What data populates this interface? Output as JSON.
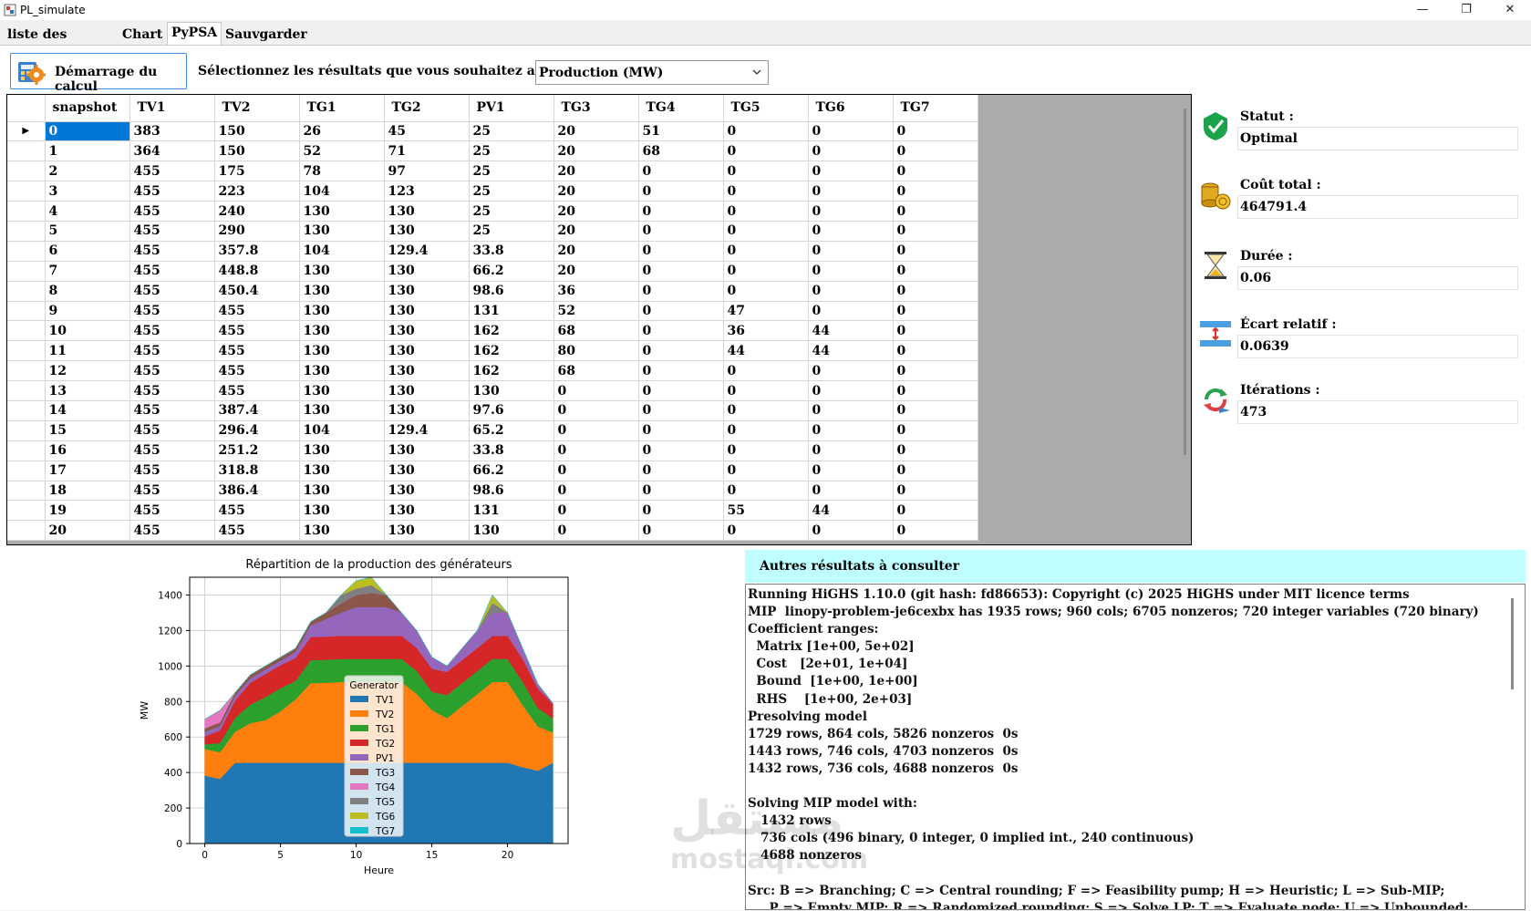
{
  "window": {
    "title": "PL_simulate",
    "min_glyph": "—",
    "max_glyph": "❐",
    "close_glyph": "✕"
  },
  "tabs": [
    "liste des priorités",
    "Chart",
    "PyPSA",
    "Sauvgarder les données"
  ],
  "toolbar": {
    "start_label": "Démarrage du calcul",
    "select_label": "Sélectionnez les résultats que vous souhaitez afficher :",
    "select_value": "Production (MW)"
  },
  "grid": {
    "columns": [
      "snapshot",
      "TV1",
      "TV2",
      "TG1",
      "TG2",
      "PV1",
      "TG3",
      "TG4",
      "TG5",
      "TG6",
      "TG7"
    ],
    "rows": [
      [
        "0",
        "383",
        "150",
        "26",
        "45",
        "25",
        "20",
        "51",
        "0",
        "0",
        "0"
      ],
      [
        "1",
        "364",
        "150",
        "52",
        "71",
        "25",
        "20",
        "68",
        "0",
        "0",
        "0"
      ],
      [
        "2",
        "455",
        "175",
        "78",
        "97",
        "25",
        "20",
        "0",
        "0",
        "0",
        "0"
      ],
      [
        "3",
        "455",
        "223",
        "104",
        "123",
        "25",
        "20",
        "0",
        "0",
        "0",
        "0"
      ],
      [
        "4",
        "455",
        "240",
        "130",
        "130",
        "25",
        "20",
        "0",
        "0",
        "0",
        "0"
      ],
      [
        "5",
        "455",
        "290",
        "130",
        "130",
        "25",
        "20",
        "0",
        "0",
        "0",
        "0"
      ],
      [
        "6",
        "455",
        "357.8",
        "104",
        "129.4",
        "33.8",
        "20",
        "0",
        "0",
        "0",
        "0"
      ],
      [
        "7",
        "455",
        "448.8",
        "130",
        "130",
        "66.2",
        "20",
        "0",
        "0",
        "0",
        "0"
      ],
      [
        "8",
        "455",
        "450.4",
        "130",
        "130",
        "98.6",
        "36",
        "0",
        "0",
        "0",
        "0"
      ],
      [
        "9",
        "455",
        "455",
        "130",
        "130",
        "131",
        "52",
        "0",
        "47",
        "0",
        "0"
      ],
      [
        "10",
        "455",
        "455",
        "130",
        "130",
        "162",
        "68",
        "0",
        "36",
        "44",
        "0"
      ],
      [
        "11",
        "455",
        "455",
        "130",
        "130",
        "162",
        "80",
        "0",
        "44",
        "44",
        "0"
      ],
      [
        "12",
        "455",
        "455",
        "130",
        "130",
        "162",
        "68",
        "0",
        "0",
        "0",
        "0"
      ],
      [
        "13",
        "455",
        "455",
        "130",
        "130",
        "130",
        "0",
        "0",
        "0",
        "0",
        "0"
      ],
      [
        "14",
        "455",
        "387.4",
        "130",
        "130",
        "97.6",
        "0",
        "0",
        "0",
        "0",
        "0"
      ],
      [
        "15",
        "455",
        "296.4",
        "104",
        "129.4",
        "65.2",
        "0",
        "0",
        "0",
        "0",
        "0"
      ],
      [
        "16",
        "455",
        "251.2",
        "130",
        "130",
        "33.8",
        "0",
        "0",
        "0",
        "0",
        "0"
      ],
      [
        "17",
        "455",
        "318.8",
        "130",
        "130",
        "66.2",
        "0",
        "0",
        "0",
        "0",
        "0"
      ],
      [
        "18",
        "455",
        "386.4",
        "130",
        "130",
        "98.6",
        "0",
        "0",
        "0",
        "0",
        "0"
      ],
      [
        "19",
        "455",
        "455",
        "130",
        "130",
        "131",
        "0",
        "0",
        "55",
        "44",
        "0"
      ],
      [
        "20",
        "455",
        "455",
        "130",
        "130",
        "130",
        "0",
        "0",
        "0",
        "0",
        "0"
      ]
    ]
  },
  "status": {
    "statut": {
      "label": "Statut :",
      "value": "Optimal"
    },
    "cout": {
      "label": "Coût total :",
      "value": "464791.4"
    },
    "duree": {
      "label": "Durée :",
      "value": "0.06"
    },
    "ecart": {
      "label": "Écart relatif :",
      "value": "0.0639"
    },
    "iter": {
      "label": "Itérations :",
      "value": "473"
    }
  },
  "results": {
    "header": "Autres résultats à consulter",
    "log": "Running HiGHS 1.10.0 (git hash: fd86653): Copyright (c) 2025 HiGHS under MIT licence terms\nMIP  linopy-problem-je6cexbx has 1935 rows; 960 cols; 6705 nonzeros; 720 integer variables (720 binary)\nCoefficient ranges:\n  Matrix [1e+00, 5e+02]\n  Cost   [2e+01, 1e+04]\n  Bound  [1e+00, 1e+00]\n  RHS    [1e+00, 2e+03]\nPresolving model\n1729 rows, 864 cols, 5826 nonzeros  0s\n1443 rows, 746 cols, 4703 nonzeros  0s\n1432 rows, 736 cols, 4688 nonzeros  0s\n\nSolving MIP model with:\n   1432 rows\n   736 cols (496 binary, 0 integer, 0 implied int., 240 continuous)\n   4688 nonzeros\n\nSrc: B => Branching; C => Central rounding; F => Feasibility pump; H => Heuristic; L => Sub-MIP;\n     P => Empty MIP; R => Randomized rounding; S => Solve LP; T => Evaluate node; U => Unbounded;"
  },
  "watermark": {
    "text": "mostaql.com",
    "arabic": "مستقل"
  },
  "chart_data": {
    "type": "area",
    "title": "Répartition de la production des générateurs",
    "xlabel": "Heure",
    "ylabel": "MW",
    "xlim": [
      -1,
      24
    ],
    "ylim": [
      0,
      1500
    ],
    "xticks": [
      0,
      5,
      10,
      15,
      20
    ],
    "yticks": [
      0,
      200,
      400,
      600,
      800,
      1000,
      1200,
      1400
    ],
    "grid": true,
    "legend_title": "Generator",
    "legend_position": "center",
    "x": [
      0,
      1,
      2,
      3,
      4,
      5,
      6,
      7,
      8,
      9,
      10,
      11,
      12,
      13,
      14,
      15,
      16,
      17,
      18,
      19,
      20,
      21,
      22,
      23
    ],
    "series": [
      {
        "name": "TV1",
        "color": "#1f77b4",
        "values": [
          383,
          364,
          455,
          455,
          455,
          455,
          455,
          455,
          455,
          455,
          455,
          455,
          455,
          455,
          455,
          455,
          455,
          455,
          455,
          455,
          455,
          430,
          410,
          455
        ]
      },
      {
        "name": "TV2",
        "color": "#ff7f0e",
        "values": [
          150,
          150,
          175,
          223,
          240,
          290,
          357.8,
          448.8,
          450.4,
          455,
          455,
          455,
          455,
          455,
          387.4,
          296.4,
          251.2,
          318.8,
          386.4,
          455,
          455,
          350,
          250,
          170
        ]
      },
      {
        "name": "TG1",
        "color": "#2ca02c",
        "values": [
          26,
          52,
          78,
          104,
          130,
          130,
          104,
          130,
          130,
          130,
          130,
          130,
          130,
          130,
          130,
          104,
          130,
          130,
          130,
          130,
          130,
          130,
          104,
          80
        ]
      },
      {
        "name": "TG2",
        "color": "#d62728",
        "values": [
          45,
          71,
          97,
          123,
          130,
          130,
          129.4,
          130,
          130,
          130,
          130,
          130,
          130,
          130,
          130,
          129.4,
          130,
          130,
          130,
          130,
          130,
          130,
          110,
          80
        ]
      },
      {
        "name": "PV1",
        "color": "#9467bd",
        "values": [
          25,
          25,
          25,
          25,
          25,
          25,
          33.8,
          66.2,
          98.6,
          131,
          162,
          162,
          162,
          130,
          97.6,
          65.2,
          33.8,
          66.2,
          98.6,
          131,
          130,
          60,
          25,
          5
        ]
      },
      {
        "name": "TG3",
        "color": "#8c564b",
        "values": [
          20,
          20,
          20,
          20,
          20,
          20,
          20,
          20,
          36,
          52,
          68,
          80,
          68,
          0,
          0,
          0,
          0,
          0,
          0,
          0,
          0,
          0,
          0,
          0
        ]
      },
      {
        "name": "TG4",
        "color": "#e377c2",
        "values": [
          51,
          68,
          0,
          0,
          0,
          0,
          0,
          0,
          0,
          0,
          0,
          0,
          0,
          0,
          0,
          0,
          0,
          0,
          0,
          0,
          0,
          0,
          0,
          0
        ]
      },
      {
        "name": "TG5",
        "color": "#7f7f7f",
        "values": [
          0,
          0,
          0,
          0,
          0,
          0,
          0,
          0,
          0,
          47,
          36,
          44,
          0,
          0,
          0,
          0,
          0,
          0,
          0,
          55,
          0,
          0,
          0,
          0
        ]
      },
      {
        "name": "TG6",
        "color": "#bcbd22",
        "values": [
          0,
          0,
          0,
          0,
          0,
          0,
          0,
          0,
          0,
          0,
          44,
          44,
          0,
          0,
          0,
          0,
          0,
          0,
          0,
          44,
          0,
          0,
          0,
          0
        ]
      },
      {
        "name": "TG7",
        "color": "#17becf",
        "values": [
          0,
          0,
          0,
          0,
          0,
          0,
          0,
          0,
          0,
          0,
          0,
          0,
          0,
          0,
          0,
          0,
          0,
          0,
          0,
          0,
          0,
          0,
          0,
          0
        ]
      }
    ]
  }
}
